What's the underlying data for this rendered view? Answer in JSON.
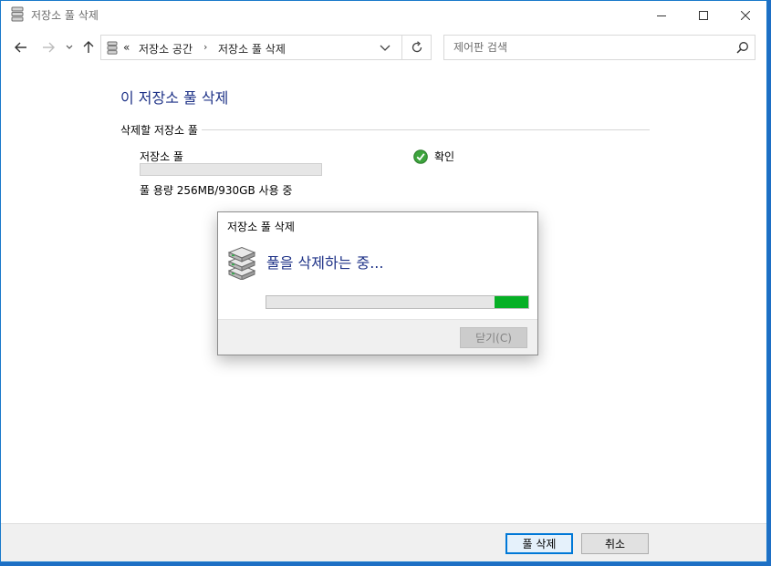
{
  "window": {
    "title": "저장소 풀 삭제"
  },
  "nav": {
    "breadcrumb_prefix": "«",
    "breadcrumbs": [
      "저장소 공간",
      "저장소 풀 삭제"
    ],
    "search_placeholder": "제어판 검색"
  },
  "content": {
    "heading": "이 저장소 풀 삭제",
    "group_label": "삭제할 저장소 풀",
    "pool": {
      "name": "저장소 풀",
      "usage": "풀 용량 256MB/930GB 사용 중",
      "status": "확인"
    }
  },
  "dialog": {
    "title": "저장소 풀 삭제",
    "message": "풀을 삭제하는 중...",
    "progress_fill_start_fraction": 0.87,
    "progress_fill_end_fraction": 1.0,
    "close_label": "닫기(C)"
  },
  "footer": {
    "delete_label": "풀 삭제",
    "cancel_label": "취소"
  },
  "colors": {
    "accent": "#0078d7",
    "heading": "#1e3287",
    "progress": "#06b025",
    "status_ok": "#2e9e2e"
  }
}
